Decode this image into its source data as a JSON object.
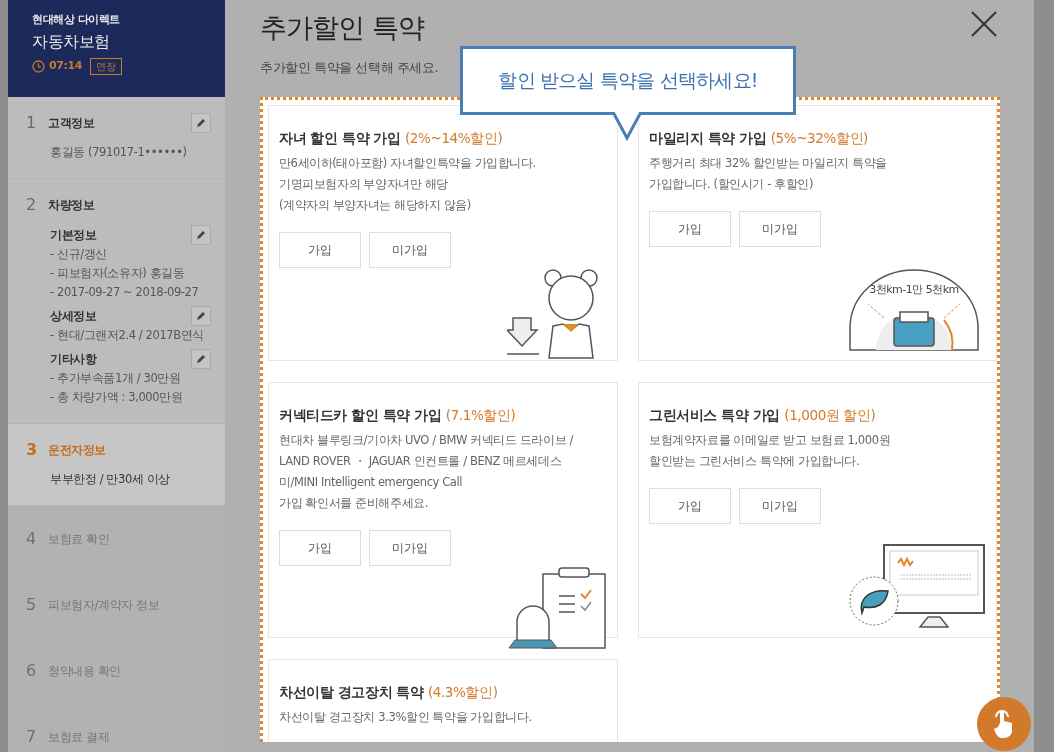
{
  "brand": {
    "company": "현대해상 다이렉트",
    "product": "자동차보험",
    "timer": "07:14",
    "extend_button": "연장"
  },
  "steps": [
    {
      "number": "1",
      "title": "고객정보",
      "selected": false,
      "disabled": false,
      "editable": true,
      "details": [
        "홍길동 (791017-1••••••)"
      ]
    },
    {
      "number": "2",
      "title": "차량정보",
      "selected": false,
      "disabled": false,
      "editable": false,
      "sections": [
        {
          "title": "기본정보",
          "details": [
            "- 신규/갱신",
            "- 피보험자(소유자) 홍길동",
            "- 2017-09-27 ~ 2018-09-27"
          ]
        },
        {
          "title": "상세정보",
          "details": [
            "- 현대/그랜저2.4 / 2017B연식"
          ]
        },
        {
          "title": "기타사항",
          "details": [
            "- 추가부속품1개 / 30만원",
            "- 총 차량가액 : 3,000만원"
          ]
        }
      ]
    },
    {
      "number": "3",
      "title": "운전자정보",
      "selected": true,
      "disabled": false,
      "editable": false,
      "details": [
        "부부한정 / 만30세 이상"
      ]
    },
    {
      "number": "4",
      "title": "보험료 확인",
      "selected": false,
      "disabled": true,
      "editable": false
    },
    {
      "number": "5",
      "title": "피보험자/계약자 정보",
      "selected": false,
      "disabled": true,
      "editable": false
    },
    {
      "number": "6",
      "title": "청약내용 확인",
      "selected": false,
      "disabled": true,
      "editable": false
    },
    {
      "number": "7",
      "title": "보험료 결제",
      "selected": false,
      "disabled": true,
      "editable": false
    }
  ],
  "dialog": {
    "title": "추가할인 특약",
    "subtitle": "추가할인 특약을 선택해 주세요.",
    "tooltip": "할인 받으실 특약을 선택하세요!"
  },
  "cards": [
    {
      "kind": "child",
      "title": "자녀 할인 특약 가입",
      "discount": "(2%~14%할인)",
      "description": [
        "만6세이하(태아포함) 자녀할인특약을 가입합니다.",
        "기명피보험자의 부양자녀만 해당",
        "(계약자의 부양자녀는 해당하지 않음)"
      ],
      "buttons": [
        "가입",
        "미가입"
      ]
    },
    {
      "kind": "mileage",
      "title": "마일리지 특약 가입",
      "discount": "(5%~32%할인)",
      "description": [
        "주행거리 최대 32% 할인받는 마일리지 특약을",
        "가입합니다. (할인시기 - 후할인)"
      ],
      "buttons": [
        "가입",
        "미가입"
      ],
      "illustration_label": "3천km-1만 5천km"
    },
    {
      "kind": "connected",
      "title": "커넥티드카 할인 특약 가입",
      "discount": "(7.1%할인)",
      "description": [
        "현대차 블루링크/기아차 UVO / BMW 커넥티드 드라이브 /",
        "LAND ROVER ・ JAGUAR 인컨트롤 / BENZ 메르세데스",
        "미/MINI Intelligent emergency Call",
        "가입 확인서를 준비해주세요."
      ],
      "buttons": [
        "가입",
        "미가입"
      ]
    },
    {
      "kind": "green",
      "title": "그린서비스 특약 가입",
      "discount": "(1,000원 할인)",
      "description": [
        "보험계약자료를 이메일로 받고 보험료 1,000원",
        "할인받는 그린서비스 특약에 가입합니다."
      ],
      "buttons": [
        "가입",
        "미가입"
      ]
    },
    {
      "kind": "lane",
      "title": "차선이탈 경고장치 특약",
      "discount": "(4.3%할인)",
      "description": [
        "차선이탈 경고장치 3.3%할인 특약을 가입합니다."
      ]
    }
  ]
}
